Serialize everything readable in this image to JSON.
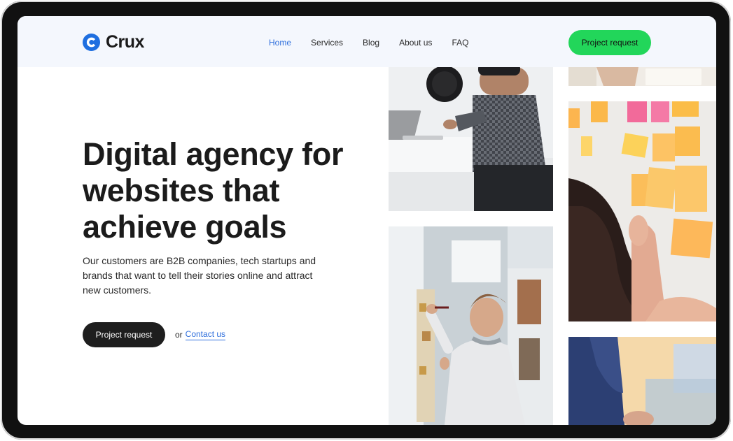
{
  "brand": {
    "name": "Crux",
    "accent_color": "#1f6fe0",
    "icon": "crux-logo-icon"
  },
  "nav": {
    "items": [
      {
        "label": "Home",
        "active": true
      },
      {
        "label": "Services",
        "active": false
      },
      {
        "label": "Blog",
        "active": false
      },
      {
        "label": "About us",
        "active": false
      },
      {
        "label": "FAQ",
        "active": false
      }
    ],
    "active_color": "#2f6fdc"
  },
  "header": {
    "cta_label": "Project request",
    "cta_color": "#22d65a"
  },
  "hero": {
    "title": "Digital agency for websites that achieve goals",
    "subtitle": "Our customers are B2B companies, tech startups and brands that want to tell their stories online and attract new customers.",
    "primary_cta": "Project request",
    "or_text": "or",
    "secondary_link": "Contact us"
  },
  "gallery": [
    {
      "name": "man-working-on-laptop-photo"
    },
    {
      "name": "man-writing-on-whiteboard-photo"
    },
    {
      "name": "hands-with-notebook-photo"
    },
    {
      "name": "sticky-notes-on-wall-photo"
    },
    {
      "name": "person-at-desk-blurred-photo"
    }
  ]
}
